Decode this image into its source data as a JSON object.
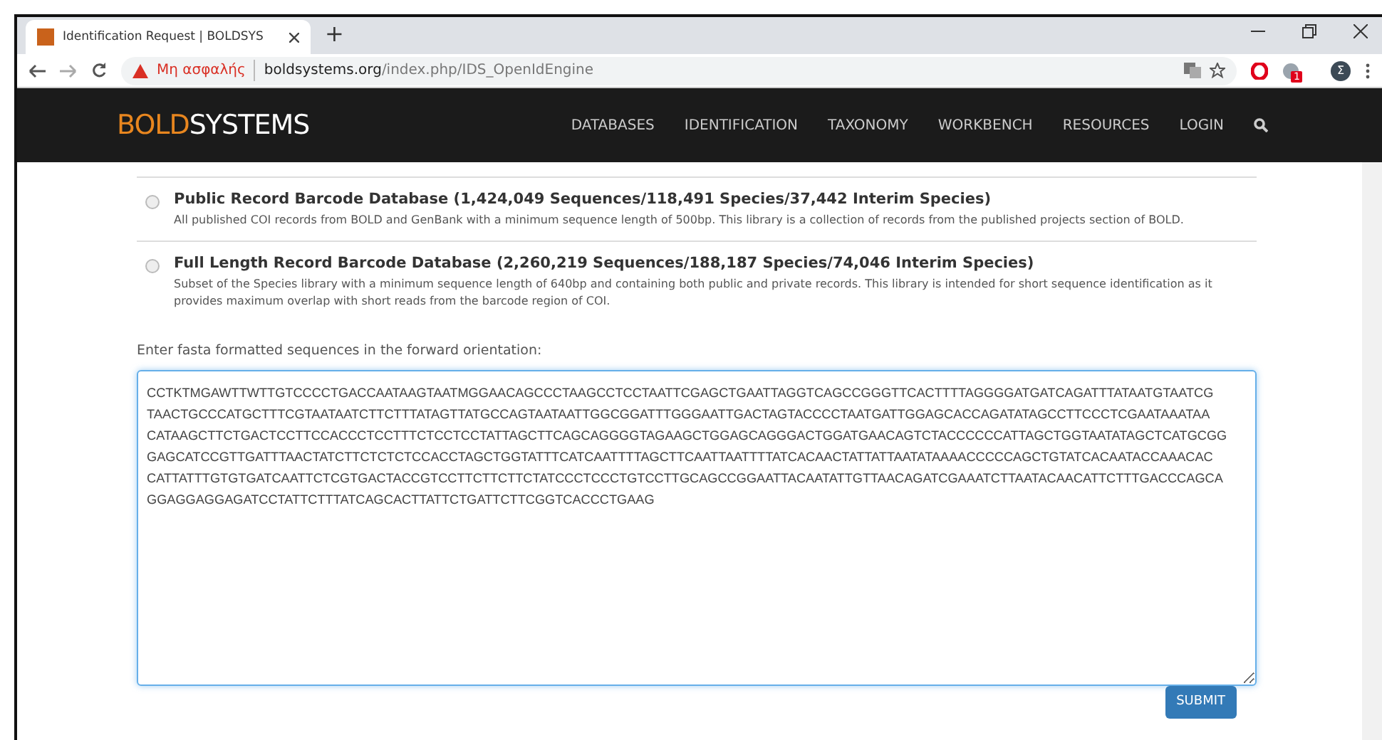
{
  "browser": {
    "tab_title": "Identification Request | BOLDSYS",
    "new_tab": "+",
    "security_warning": "Μη ασφαλής",
    "url_host": "boldsystems.org",
    "url_path": "/index.php/IDS_OpenIdEngine",
    "extension_badge": "1",
    "profile_initial": "Σ"
  },
  "navbar": {
    "logo_bold": "BOLD",
    "logo_systems": "SYSTEMS",
    "items": [
      {
        "label": "DATABASES"
      },
      {
        "label": "IDENTIFICATION"
      },
      {
        "label": "TAXONOMY"
      },
      {
        "label": "WORKBENCH"
      },
      {
        "label": "RESOURCES"
      },
      {
        "label": "LOGIN"
      }
    ]
  },
  "databases": [
    {
      "title": "Public Record Barcode Database (1,424,049 Sequences/118,491 Species/37,442 Interim Species)",
      "description": "All published COI records from BOLD and GenBank with a minimum sequence length of 500bp. This library is a collection of records from the published projects section of BOLD.",
      "selected": false
    },
    {
      "title": "Full Length Record Barcode Database (2,260,219 Sequences/188,187 Species/74,046 Interim Species)",
      "description": "Subset of the Species library with a minimum sequence length of 640bp and containing both public and private records. This library is intended for short sequence identification as it provides maximum overlap with short reads from the barcode region of COI.",
      "selected": false
    }
  ],
  "sequence_label": "Enter fasta formatted sequences in the forward orientation:",
  "sequence_lines": [
    "CCTKTMGAWTTWTTGTCCCCTGACCAATAAGTAATMGGAACAGCCCTAAGCCTCCTAATTCGAGCTGAATTAGGTCAGCCGGGTTCACTTTTAGGGGATGATCAGATTTATAATGTAATCG",
    "TAACTGCCCATGCTTTCGTAATAATCTTCTTTATAGTTATGCCAGTAATAATTGGCGGATTTGGGAATTGACTAGTACCCCTAATGATTGGAGCACCAGATATAGCCTTCCCTCGAATAAATAA",
    "CATAAGCTTCTGACTCCTTCCACCCTCCTTTCTCCTCCTATTAGCTTCAGCAGGGGTAGAAGCTGGAGCAGGGACTGGATGAACAGTCTACCCCCCATTAGCTGGTAATATAGCTCATGCGG",
    "GAGCATCCGTTGATTTAACTATCTTCTCTCTCCACCTAGCTGGTATTTCATCAATTTTAGCTTCAATTAATTTTATCACAACTATTATTAATATAAAACCCCCAGCTGTATCACAATACCAAACAC",
    "CATTATTTGTGTGATCAATTCTCGTGACTACCGTCCTTCTTCTTCTATCCCTCCCTGTCCTTGCAGCCGGAATTACAATATTGTTAACAGATCGAAATCTTAATACAACATTCTTTGACCCAGCA",
    "GGAGGAGGAGATCCTATTCTTTATCAGCACTTATTCTGATTCTTCGGTCACCCTGAAG"
  ],
  "submit": "SUBMIT"
}
